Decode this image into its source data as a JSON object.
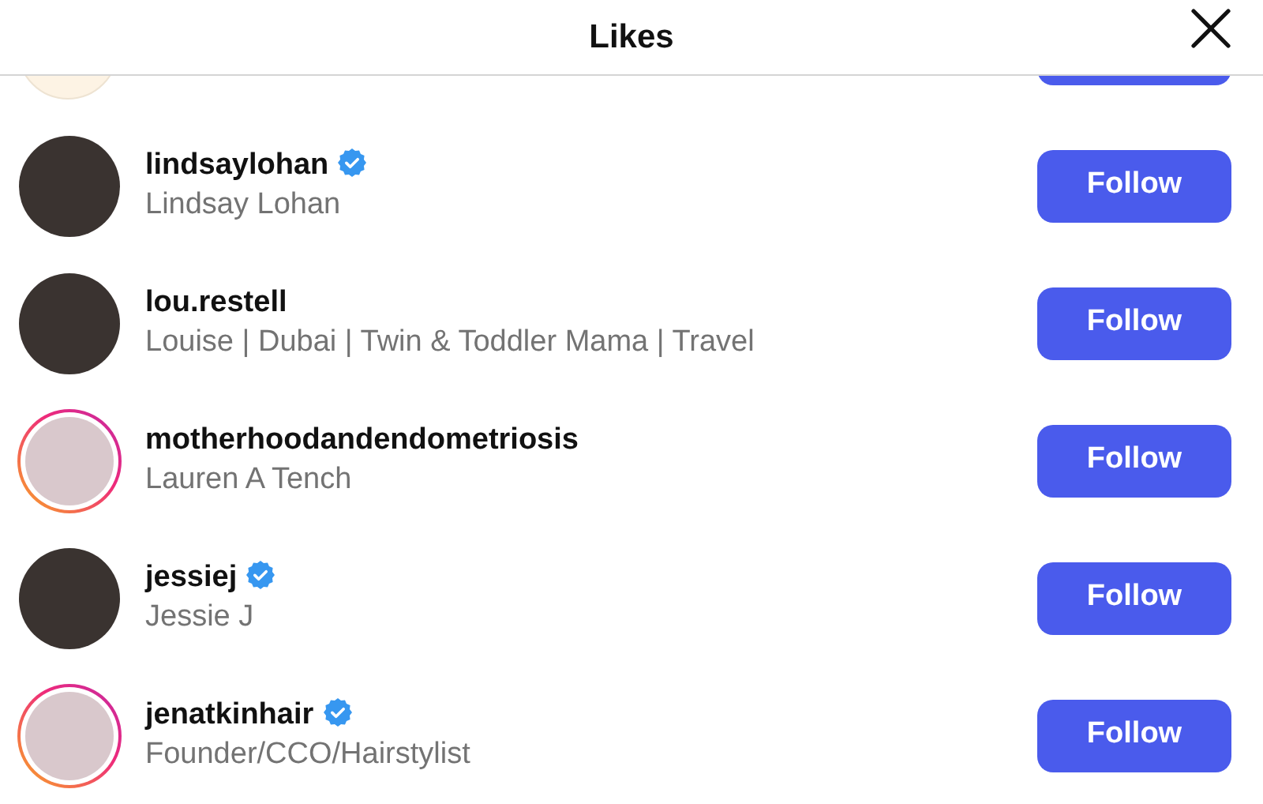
{
  "header": {
    "title": "Likes"
  },
  "users": [
    {
      "username": "lindsaylohan",
      "full_name": "Lindsay Lohan",
      "verified": true,
      "story_ring": false,
      "button": "Follow"
    },
    {
      "username": "lou.restell",
      "full_name": "Louise | Dubai | Twin & Toddler Mama | Travel",
      "verified": false,
      "story_ring": false,
      "button": "Follow"
    },
    {
      "username": "motherhoodandendometriosis",
      "full_name": "Lauren A Tench",
      "verified": false,
      "story_ring": true,
      "button": "Follow"
    },
    {
      "username": "jessiej",
      "full_name": "Jessie J",
      "verified": true,
      "story_ring": false,
      "button": "Follow"
    },
    {
      "username": "jenatkinhair",
      "full_name": "Founder/CCO/Hairstylist",
      "verified": true,
      "story_ring": true,
      "button": "Follow"
    }
  ]
}
